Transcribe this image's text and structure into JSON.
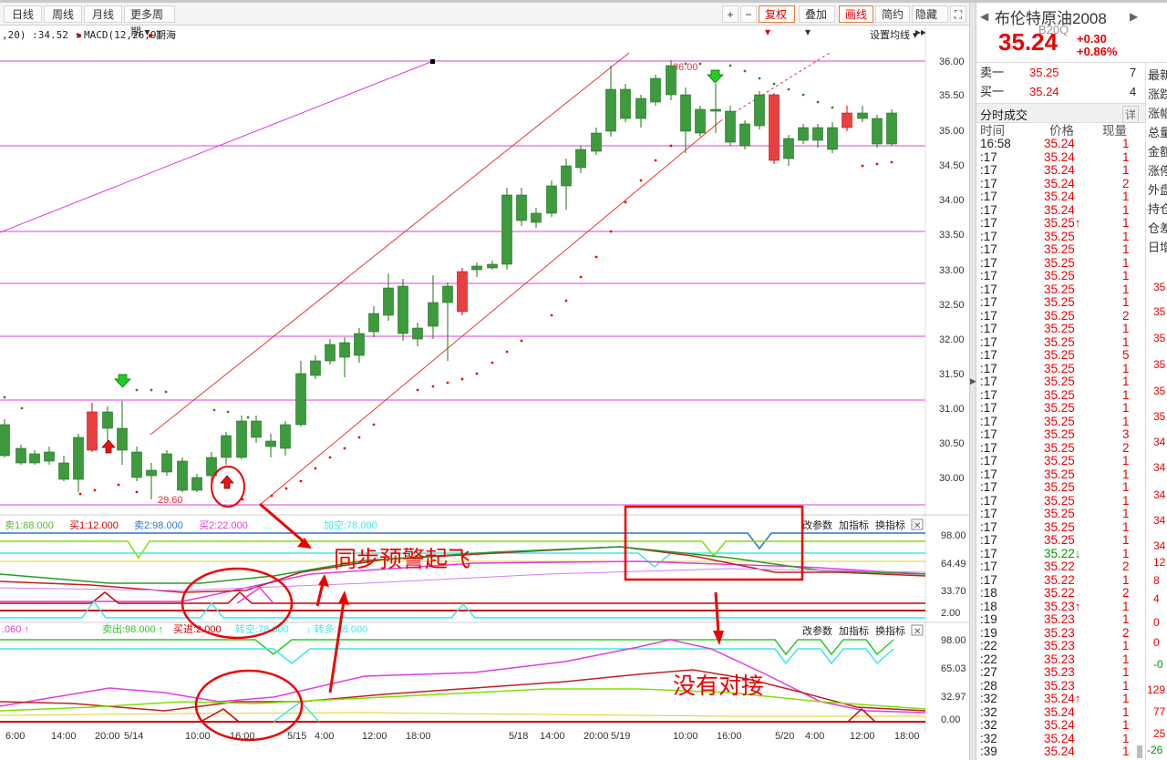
{
  "toolbar": {
    "periods": [
      "日线",
      "周线",
      "月线",
      "更多周期 ▾"
    ],
    "right_buttons": [
      "+",
      "−",
      "复权 ▾",
      "叠加 ▾",
      "画线",
      "简约",
      "隐藏 ▸▸"
    ]
  },
  "indicator_header": {
    "left_text": ",20) :34.52 ↑",
    "macd": "MACD(12,26,9)",
    "second": "期海",
    "setting": "设置均线 ▾"
  },
  "price_axis": [
    "36.00",
    "35.50",
    "35.00",
    "34.50",
    "34.00",
    "33.50",
    "33.00",
    "32.50",
    "32.00",
    "31.50",
    "31.00",
    "30.50",
    "30.00"
  ],
  "channel_labels": {
    "top": "36.00",
    "bottom": "29.60"
  },
  "sub1": {
    "legend": [
      "卖1:88.000",
      "买1:12.000",
      "卖2:98.000",
      "买2:22.000",
      "...",
      "加空:78.000"
    ],
    "buttons": [
      "改参数",
      "加指标",
      "换指标"
    ],
    "axis": [
      "98.00",
      "64.49",
      "33.70",
      "2.00"
    ]
  },
  "sub2": {
    "legend": [
      ".060 ↑",
      "卖出:98.000 ↑",
      "买进:2.000",
      "转空:78.000",
      "↓ 转多:18.000"
    ],
    "buttons": [
      "改参数",
      "加指标",
      "换指标"
    ],
    "axis": [
      "98.00",
      "65.03",
      "32.97",
      "0.00"
    ]
  },
  "time_axis": [
    "6:00",
    "14:00",
    "20:00",
    "5/14",
    "10:00",
    "16:00",
    "5/15",
    "4:00",
    "12:00",
    "18:00",
    "5/18",
    "14:00",
    "20:00",
    "5/19",
    "10:00",
    "16:00",
    "5/20",
    "4:00",
    "12:00",
    "18:00"
  ],
  "annotations": {
    "sync": "同步预警起飞",
    "no_connect": "没有对接"
  },
  "quote": {
    "name": "布伦特原油2008",
    "code": "B20Q",
    "price": "35.24",
    "change": "+0.30",
    "change_pct": "+0.86%",
    "sell1_label": "卖一",
    "sell1_price": "35.25",
    "sell1_vol": "7",
    "buy1_label": "买一",
    "buy1_price": "35.24",
    "buy1_vol": "4",
    "side_labels": [
      "最新",
      "涨跌",
      "涨幅",
      "总量",
      "金额",
      "涨停",
      "外盘",
      "持仓",
      "仓差",
      "日增"
    ],
    "ticks_title": "分时成交",
    "ticks_button": "详",
    "ticks_headers": [
      "时间",
      "价格",
      "现量"
    ],
    "ticks": [
      [
        "16:58",
        "35.24",
        "1"
      ],
      [
        ":17",
        "35.24",
        "1"
      ],
      [
        ":17",
        "35.24",
        "1"
      ],
      [
        ":17",
        "35.24",
        "2"
      ],
      [
        ":17",
        "35.24",
        "1"
      ],
      [
        ":17",
        "35.24",
        "1"
      ],
      [
        ":17",
        "35.25↑",
        "1"
      ],
      [
        ":17",
        "35.25",
        "1"
      ],
      [
        ":17",
        "35.25",
        "1"
      ],
      [
        ":17",
        "35.25",
        "1"
      ],
      [
        ":17",
        "35.25",
        "1"
      ],
      [
        ":17",
        "35.25",
        "1"
      ],
      [
        ":17",
        "35.25",
        "1"
      ],
      [
        ":17",
        "35.25",
        "2"
      ],
      [
        ":17",
        "35.25",
        "1"
      ],
      [
        ":17",
        "35.25",
        "1"
      ],
      [
        ":17",
        "35.25",
        "5"
      ],
      [
        ":17",
        "35.25",
        "1"
      ],
      [
        ":17",
        "35.25",
        "1"
      ],
      [
        ":17",
        "35.25",
        "1"
      ],
      [
        ":17",
        "35.25",
        "1"
      ],
      [
        ":17",
        "35.25",
        "1"
      ],
      [
        ":17",
        "35.25",
        "3"
      ],
      [
        ":17",
        "35.25",
        "2"
      ],
      [
        ":17",
        "35.25",
        "1"
      ],
      [
        ":17",
        "35.25",
        "1"
      ],
      [
        ":17",
        "35.25",
        "1"
      ],
      [
        ":17",
        "35.25",
        "1"
      ],
      [
        ":17",
        "35.25",
        "1"
      ],
      [
        ":17",
        "35.25",
        "1"
      ],
      [
        ":17",
        "35.25",
        "1"
      ],
      [
        ":17",
        "35.22↓",
        "1"
      ],
      [
        ":17",
        "35.22",
        "2"
      ],
      [
        ":17",
        "35.22",
        "1"
      ],
      [
        ":18",
        "35.22",
        "2"
      ],
      [
        ":18",
        "35.23↑",
        "1"
      ],
      [
        ":19",
        "35.23",
        "1"
      ],
      [
        ":19",
        "35.23",
        "2"
      ],
      [
        ":22",
        "35.23",
        "1"
      ],
      [
        ":22",
        "35.23",
        "1"
      ],
      [
        ":27",
        "35.23",
        "1"
      ],
      [
        ":28",
        "35.23",
        "1"
      ],
      [
        ":32",
        "35.24↑",
        "1"
      ],
      [
        ":32",
        "35.24",
        "1"
      ],
      [
        ":32",
        "35.24",
        "1"
      ],
      [
        ":32",
        "35.24",
        "1"
      ],
      [
        ":39",
        "35.24",
        "1"
      ]
    ],
    "edge_values": [
      "35",
      "35",
      "35",
      "35",
      "35",
      "35",
      "34",
      "34",
      "34",
      "34",
      "34",
      "12",
      "8",
      "4",
      "0",
      "0",
      "-0",
      "129",
      "77",
      "25",
      "-26",
      "分时"
    ]
  }
}
